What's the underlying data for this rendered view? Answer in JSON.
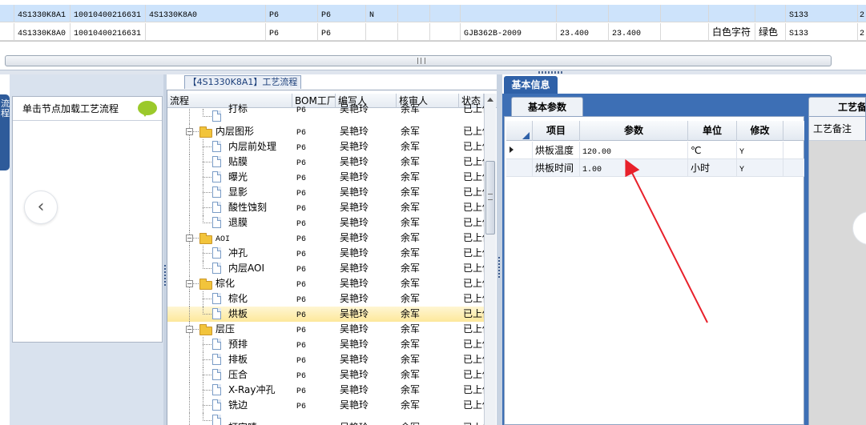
{
  "top_grid": {
    "rows": [
      {
        "c1": "4S1330K8A1",
        "c2": "10010400216631",
        "c3": "4S1330K8A0",
        "c4": "P6",
        "c5": "P6",
        "c6": "N",
        "c7": "",
        "c8": "",
        "c9": "",
        "c10": "",
        "c11": "",
        "c12": "S133",
        "c13": "2"
      },
      {
        "c1": "4S1330K8A0",
        "c2": "10010400216631",
        "c3": "",
        "c4": "P6",
        "c5": "P6",
        "c6": "",
        "c7": "GJB362B-2009",
        "c8": "23.400",
        "c9": "23.400",
        "c10": "白色字符",
        "c11": "绿色",
        "c12": "S133",
        "c13": "2"
      }
    ]
  },
  "left_panel": {
    "side_tab": "流程",
    "header": "单击节点加载工艺流程",
    "prev_icon": "‹"
  },
  "flow": {
    "title": "【4S1330K8A1】工艺流程",
    "columns": [
      "流程",
      "BOM工厂",
      "编写人",
      "核审人",
      "状态"
    ],
    "sort_icon": "▲",
    "rows": [
      {
        "level": 2,
        "type": "doc",
        "label": "打标",
        "bom": "P6",
        "writer": "吴艳玲",
        "reviewer": "余军",
        "status": "已上传",
        "partial": true
      },
      {
        "level": 1,
        "type": "folder",
        "label": "内层图形",
        "bom": "P6",
        "writer": "吴艳玲",
        "reviewer": "余军",
        "status": "已上传"
      },
      {
        "level": 2,
        "type": "doc",
        "label": "内层前处理",
        "bom": "P6",
        "writer": "吴艳玲",
        "reviewer": "余军",
        "status": "已上传"
      },
      {
        "level": 2,
        "type": "doc",
        "label": "贴膜",
        "bom": "P6",
        "writer": "吴艳玲",
        "reviewer": "余军",
        "status": "已上传"
      },
      {
        "level": 2,
        "type": "doc",
        "label": "曝光",
        "bom": "P6",
        "writer": "吴艳玲",
        "reviewer": "余军",
        "status": "已上传"
      },
      {
        "level": 2,
        "type": "doc",
        "label": "显影",
        "bom": "P6",
        "writer": "吴艳玲",
        "reviewer": "余军",
        "status": "已上传"
      },
      {
        "level": 2,
        "type": "doc",
        "label": "酸性蚀刻",
        "bom": "P6",
        "writer": "吴艳玲",
        "reviewer": "余军",
        "status": "已上传"
      },
      {
        "level": 2,
        "type": "doc",
        "label": "退膜",
        "bom": "P6",
        "writer": "吴艳玲",
        "reviewer": "余军",
        "status": "已上传"
      },
      {
        "level": 1,
        "type": "folder",
        "label": "AOI",
        "bom": "P6",
        "writer": "吴艳玲",
        "reviewer": "余军",
        "status": "已上传"
      },
      {
        "level": 2,
        "type": "doc",
        "label": "冲孔",
        "bom": "P6",
        "writer": "吴艳玲",
        "reviewer": "余军",
        "status": "已上传"
      },
      {
        "level": 2,
        "type": "doc",
        "label": "内层AOI",
        "bom": "P6",
        "writer": "吴艳玲",
        "reviewer": "余军",
        "status": "已上传"
      },
      {
        "level": 1,
        "type": "folder",
        "label": "棕化",
        "bom": "P6",
        "writer": "吴艳玲",
        "reviewer": "余军",
        "status": "已上传"
      },
      {
        "level": 2,
        "type": "doc",
        "label": "棕化",
        "bom": "P6",
        "writer": "吴艳玲",
        "reviewer": "余军",
        "status": "已上传"
      },
      {
        "level": 2,
        "type": "doc",
        "label": "烘板",
        "bom": "P6",
        "writer": "吴艳玲",
        "reviewer": "余军",
        "status": "已上传",
        "selected": true
      },
      {
        "level": 1,
        "type": "folder",
        "label": "层压",
        "bom": "P6",
        "writer": "吴艳玲",
        "reviewer": "余军",
        "status": "已上传"
      },
      {
        "level": 2,
        "type": "doc",
        "label": "预排",
        "bom": "P6",
        "writer": "吴艳玲",
        "reviewer": "余军",
        "status": "已上传"
      },
      {
        "level": 2,
        "type": "doc",
        "label": "排板",
        "bom": "P6",
        "writer": "吴艳玲",
        "reviewer": "余军",
        "status": "已上传"
      },
      {
        "level": 2,
        "type": "doc",
        "label": "压合",
        "bom": "P6",
        "writer": "吴艳玲",
        "reviewer": "余军",
        "status": "已上传"
      },
      {
        "level": 2,
        "type": "doc",
        "label": "X-Ray冲孔",
        "bom": "P6",
        "writer": "吴艳玲",
        "reviewer": "余军",
        "status": "已上传"
      },
      {
        "level": 2,
        "type": "doc",
        "label": "铣边",
        "bom": "P6",
        "writer": "吴艳玲",
        "reviewer": "余军",
        "status": "已上传"
      },
      {
        "level": 2,
        "type": "doc",
        "label": "打字唛",
        "bom": "P6",
        "writer": "吴艳玲",
        "reviewer": "余军",
        "status": "已上传",
        "partial": true
      }
    ]
  },
  "info": {
    "tab": "基本信息",
    "params_tab": "基本参数",
    "columns": [
      "项目",
      "参数",
      "单位",
      "修改"
    ],
    "rows": [
      {
        "item": "烘板温度",
        "value": "120.00",
        "unit": "℃",
        "modify": "Y",
        "current": true
      },
      {
        "item": "烘板时间",
        "value": "1.00",
        "unit": "小时",
        "modify": "Y"
      }
    ]
  },
  "remark": {
    "tab": "工艺备",
    "header": "工艺备注"
  },
  "colors": {
    "accent_blue": "#2f61a8",
    "selection_yellow": "#fde89a",
    "annotation_red": "#e8212b"
  }
}
